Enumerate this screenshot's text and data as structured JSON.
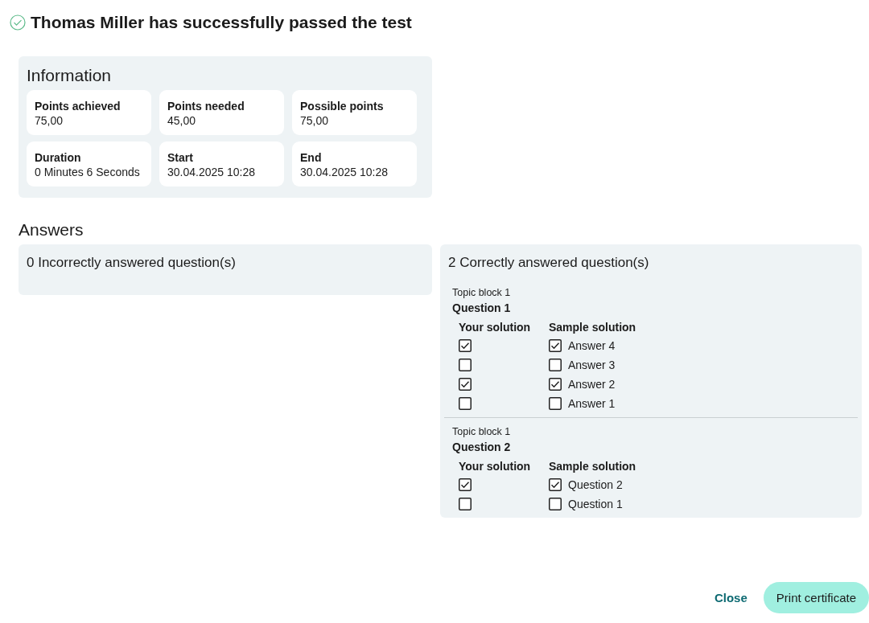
{
  "title": "Thomas Miller has successfully passed the test",
  "information": {
    "heading": "Information",
    "items": [
      {
        "label": "Points achieved",
        "value": "75,00"
      },
      {
        "label": "Points needed",
        "value": "45,00"
      },
      {
        "label": "Possible points",
        "value": "75,00"
      },
      {
        "label": "Duration",
        "value": "0 Minutes 6 Seconds"
      },
      {
        "label": "Start",
        "value": "30.04.2025 10:28"
      },
      {
        "label": "End",
        "value": "30.04.2025 10:28"
      }
    ]
  },
  "answers": {
    "heading": "Answers",
    "incorrect": {
      "heading": "0 Incorrectly answered question(s)"
    },
    "correct": {
      "heading": "2 Correctly answered question(s)",
      "questions": [
        {
          "topic": "Topic block 1",
          "question": "Question 1",
          "your_heading": "Your solution",
          "sample_heading": "Sample solution",
          "options": [
            {
              "yours": true,
              "sample": true,
              "label": "Answer 4"
            },
            {
              "yours": false,
              "sample": false,
              "label": "Answer 3"
            },
            {
              "yours": true,
              "sample": true,
              "label": "Answer 2"
            },
            {
              "yours": false,
              "sample": false,
              "label": "Answer 1"
            }
          ]
        },
        {
          "topic": "Topic block 1",
          "question": "Question 2",
          "your_heading": "Your solution",
          "sample_heading": "Sample solution",
          "options": [
            {
              "yours": true,
              "sample": true,
              "label": "Question 2"
            },
            {
              "yours": false,
              "sample": false,
              "label": "Question 1"
            }
          ]
        }
      ]
    }
  },
  "buttons": {
    "close": "Close",
    "print": "Print certificate"
  }
}
